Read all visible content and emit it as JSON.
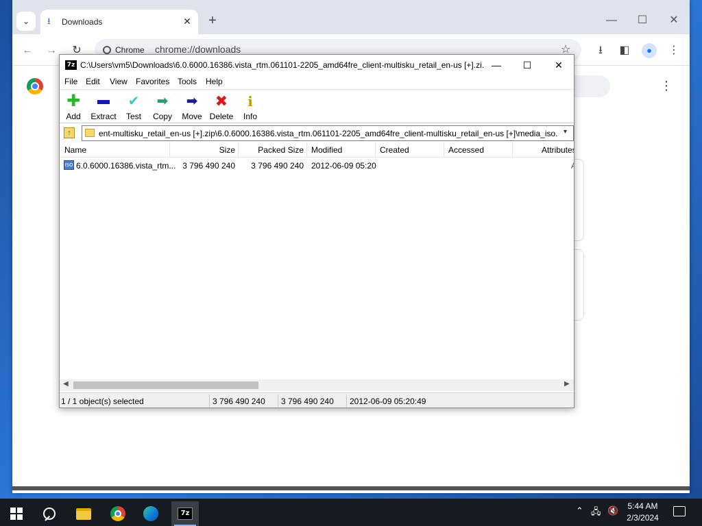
{
  "chrome": {
    "tab_title": "Downloads",
    "omnibox_chip": "Chrome",
    "omnibox_url": "chrome://downloads"
  },
  "zip": {
    "title": "C:\\Users\\vm5\\Downloads\\6.0.6000.16386.vista_rtm.061101-2205_amd64fre_client-multisku_retail_en-us [+].zi...",
    "app_icon_text": "7z",
    "menu": [
      "File",
      "Edit",
      "View",
      "Favorites",
      "Tools",
      "Help"
    ],
    "toolbar": [
      {
        "label": "Add",
        "icon": "plus-icon",
        "color": "#2bb52b"
      },
      {
        "label": "Extract",
        "icon": "minus-icon",
        "color": "#1a1aa8"
      },
      {
        "label": "Test",
        "icon": "check-icon",
        "color": "#3ac8c8"
      },
      {
        "label": "Copy",
        "icon": "copy-arrow-icon",
        "color": "#2a9a7a"
      },
      {
        "label": "Move",
        "icon": "move-arrow-icon",
        "color": "#1a1a8a"
      },
      {
        "label": "Delete",
        "icon": "delete-x-icon",
        "color": "#d81a1a"
      },
      {
        "label": "Info",
        "icon": "info-icon",
        "color": "#b8a000"
      }
    ],
    "address": "ent-multisku_retail_en-us [+].zip\\6.0.6000.16386.vista_rtm.061101-2205_amd64fre_client-multisku_retail_en-us [+]\\media_iso.rar\\",
    "columns": [
      "Name",
      "Size",
      "Packed Size",
      "Modified",
      "Created",
      "Accessed",
      "Attributes"
    ],
    "rows": [
      {
        "name": "6.0.6000.16386.vista_rtm...",
        "icon_text": "ISO",
        "size": "3 796 490 240",
        "packed_size": "3 796 490 240",
        "modified": "2012-06-09 05:20",
        "attributes": "A"
      }
    ],
    "status": {
      "selected": "1 / 1 object(s) selected",
      "size": "3 796 490 240",
      "packed": "3 796 490 240",
      "modified": "2012-06-09 05:20:49"
    }
  },
  "taskbar": {
    "sevenzip_label": "7z",
    "time": "5:44 AM",
    "date": "2/3/2024"
  }
}
